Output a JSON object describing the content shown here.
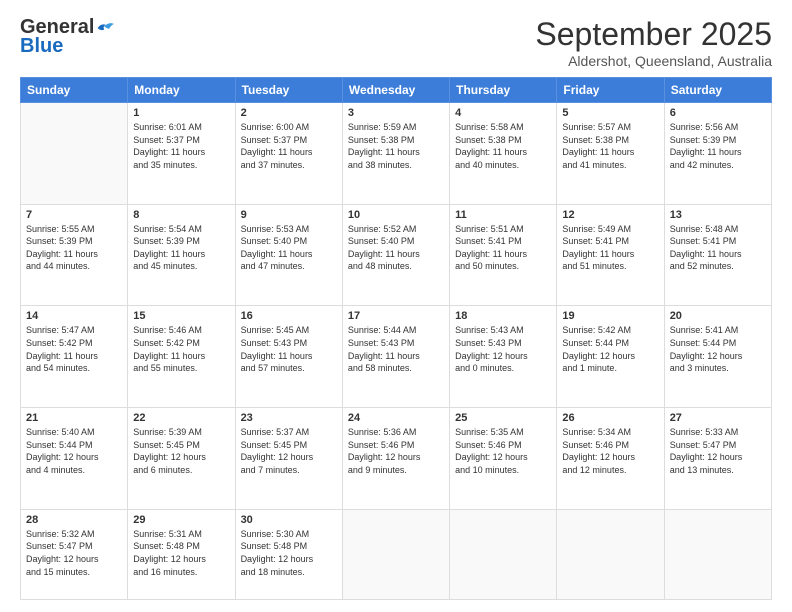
{
  "logo": {
    "general": "General",
    "blue": "Blue"
  },
  "title": "September 2025",
  "location": "Aldershot, Queensland, Australia",
  "days_header": [
    "Sunday",
    "Monday",
    "Tuesday",
    "Wednesday",
    "Thursday",
    "Friday",
    "Saturday"
  ],
  "weeks": [
    [
      {
        "day": "",
        "info": ""
      },
      {
        "day": "1",
        "info": "Sunrise: 6:01 AM\nSunset: 5:37 PM\nDaylight: 11 hours\nand 35 minutes."
      },
      {
        "day": "2",
        "info": "Sunrise: 6:00 AM\nSunset: 5:37 PM\nDaylight: 11 hours\nand 37 minutes."
      },
      {
        "day": "3",
        "info": "Sunrise: 5:59 AM\nSunset: 5:38 PM\nDaylight: 11 hours\nand 38 minutes."
      },
      {
        "day": "4",
        "info": "Sunrise: 5:58 AM\nSunset: 5:38 PM\nDaylight: 11 hours\nand 40 minutes."
      },
      {
        "day": "5",
        "info": "Sunrise: 5:57 AM\nSunset: 5:38 PM\nDaylight: 11 hours\nand 41 minutes."
      },
      {
        "day": "6",
        "info": "Sunrise: 5:56 AM\nSunset: 5:39 PM\nDaylight: 11 hours\nand 42 minutes."
      }
    ],
    [
      {
        "day": "7",
        "info": "Sunrise: 5:55 AM\nSunset: 5:39 PM\nDaylight: 11 hours\nand 44 minutes."
      },
      {
        "day": "8",
        "info": "Sunrise: 5:54 AM\nSunset: 5:39 PM\nDaylight: 11 hours\nand 45 minutes."
      },
      {
        "day": "9",
        "info": "Sunrise: 5:53 AM\nSunset: 5:40 PM\nDaylight: 11 hours\nand 47 minutes."
      },
      {
        "day": "10",
        "info": "Sunrise: 5:52 AM\nSunset: 5:40 PM\nDaylight: 11 hours\nand 48 minutes."
      },
      {
        "day": "11",
        "info": "Sunrise: 5:51 AM\nSunset: 5:41 PM\nDaylight: 11 hours\nand 50 minutes."
      },
      {
        "day": "12",
        "info": "Sunrise: 5:49 AM\nSunset: 5:41 PM\nDaylight: 11 hours\nand 51 minutes."
      },
      {
        "day": "13",
        "info": "Sunrise: 5:48 AM\nSunset: 5:41 PM\nDaylight: 11 hours\nand 52 minutes."
      }
    ],
    [
      {
        "day": "14",
        "info": "Sunrise: 5:47 AM\nSunset: 5:42 PM\nDaylight: 11 hours\nand 54 minutes."
      },
      {
        "day": "15",
        "info": "Sunrise: 5:46 AM\nSunset: 5:42 PM\nDaylight: 11 hours\nand 55 minutes."
      },
      {
        "day": "16",
        "info": "Sunrise: 5:45 AM\nSunset: 5:43 PM\nDaylight: 11 hours\nand 57 minutes."
      },
      {
        "day": "17",
        "info": "Sunrise: 5:44 AM\nSunset: 5:43 PM\nDaylight: 11 hours\nand 58 minutes."
      },
      {
        "day": "18",
        "info": "Sunrise: 5:43 AM\nSunset: 5:43 PM\nDaylight: 12 hours\nand 0 minutes."
      },
      {
        "day": "19",
        "info": "Sunrise: 5:42 AM\nSunset: 5:44 PM\nDaylight: 12 hours\nand 1 minute."
      },
      {
        "day": "20",
        "info": "Sunrise: 5:41 AM\nSunset: 5:44 PM\nDaylight: 12 hours\nand 3 minutes."
      }
    ],
    [
      {
        "day": "21",
        "info": "Sunrise: 5:40 AM\nSunset: 5:44 PM\nDaylight: 12 hours\nand 4 minutes."
      },
      {
        "day": "22",
        "info": "Sunrise: 5:39 AM\nSunset: 5:45 PM\nDaylight: 12 hours\nand 6 minutes."
      },
      {
        "day": "23",
        "info": "Sunrise: 5:37 AM\nSunset: 5:45 PM\nDaylight: 12 hours\nand 7 minutes."
      },
      {
        "day": "24",
        "info": "Sunrise: 5:36 AM\nSunset: 5:46 PM\nDaylight: 12 hours\nand 9 minutes."
      },
      {
        "day": "25",
        "info": "Sunrise: 5:35 AM\nSunset: 5:46 PM\nDaylight: 12 hours\nand 10 minutes."
      },
      {
        "day": "26",
        "info": "Sunrise: 5:34 AM\nSunset: 5:46 PM\nDaylight: 12 hours\nand 12 minutes."
      },
      {
        "day": "27",
        "info": "Sunrise: 5:33 AM\nSunset: 5:47 PM\nDaylight: 12 hours\nand 13 minutes."
      }
    ],
    [
      {
        "day": "28",
        "info": "Sunrise: 5:32 AM\nSunset: 5:47 PM\nDaylight: 12 hours\nand 15 minutes."
      },
      {
        "day": "29",
        "info": "Sunrise: 5:31 AM\nSunset: 5:48 PM\nDaylight: 12 hours\nand 16 minutes."
      },
      {
        "day": "30",
        "info": "Sunrise: 5:30 AM\nSunset: 5:48 PM\nDaylight: 12 hours\nand 18 minutes."
      },
      {
        "day": "",
        "info": ""
      },
      {
        "day": "",
        "info": ""
      },
      {
        "day": "",
        "info": ""
      },
      {
        "day": "",
        "info": ""
      }
    ]
  ]
}
